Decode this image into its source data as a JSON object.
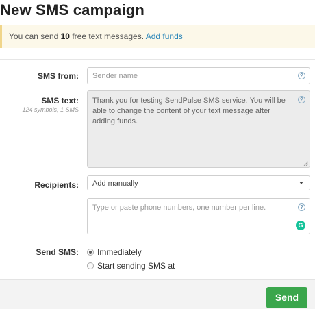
{
  "page": {
    "title": "New SMS campaign"
  },
  "notice": {
    "prefix": "You can send ",
    "count": "10",
    "suffix": " free text messages. ",
    "link": "Add funds",
    "color_bg": "#fcf8e9",
    "color_border": "#f0d58a"
  },
  "form": {
    "sms_from": {
      "label": "SMS from:",
      "placeholder": "Sender name",
      "help_icon": "question-circle-icon"
    },
    "sms_text": {
      "label": "SMS text:",
      "sublabel": "124 symbols, 1 SMS",
      "value": "Thank you for testing SendPulse SMS service. You will be able to change the content of your text message after adding funds.",
      "help_icon": "question-circle-icon"
    },
    "recipients": {
      "label": "Recipients:",
      "selected": "Add manually",
      "placeholder": "Type or paste phone numbers, one number per line.",
      "help_icon": "question-circle-icon",
      "extension_icon": "grammarly-icon"
    },
    "send_sms": {
      "label": "Send SMS:",
      "options": [
        {
          "label": "Immediately",
          "selected": true
        },
        {
          "label": "Start sending SMS at",
          "selected": false
        }
      ]
    }
  },
  "footer": {
    "send_label": "Send",
    "send_color": "#3aa64c"
  }
}
